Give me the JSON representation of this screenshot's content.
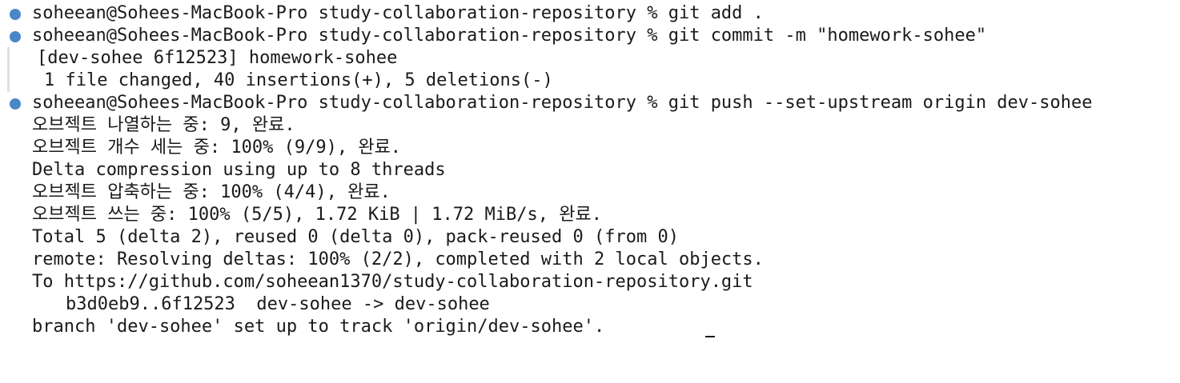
{
  "terminal": {
    "lines": [
      {
        "text": "soheean@Sohees-MacBook-Pro study-collaboration-repository % git add ."
      },
      {
        "text": "soheean@Sohees-MacBook-Pro study-collaboration-repository % git commit -m \"homework-sohee\""
      },
      {
        "text": "[dev-sohee 6f12523] homework-sohee"
      },
      {
        "text": "1 file changed, 40 insertions(+), 5 deletions(-)"
      },
      {
        "text": "soheean@Sohees-MacBook-Pro study-collaboration-repository % git push --set-upstream origin dev-sohee"
      },
      {
        "text": "오브젝트 나열하는 중: 9, 완료."
      },
      {
        "text": "오브젝트 개수 세는 중: 100% (9/9), 완료."
      },
      {
        "text": "Delta compression using up to 8 threads"
      },
      {
        "text": "오브젝트 압축하는 중: 100% (4/4), 완료."
      },
      {
        "text": "오브젝트 쓰는 중: 100% (5/5), 1.72 KiB | 1.72 MiB/s, 완료."
      },
      {
        "text": "Total 5 (delta 2), reused 0 (delta 0), pack-reused 0 (from 0)"
      },
      {
        "text": "remote: Resolving deltas: 100% (2/2), completed with 2 local objects."
      },
      {
        "text": "To https://github.com/soheean1370/study-collaboration-repository.git"
      },
      {
        "text": "b3d0eb9..6f12523  dev-sohee -> dev-sohee"
      },
      {
        "text": "branch 'dev-sohee' set up to track 'origin/dev-sohee'."
      }
    ],
    "colors": {
      "background": "#ffffff",
      "text": "#1a1a1a",
      "prompt_marker": "#4a86c8",
      "gutter": "#dcdfe6"
    }
  }
}
